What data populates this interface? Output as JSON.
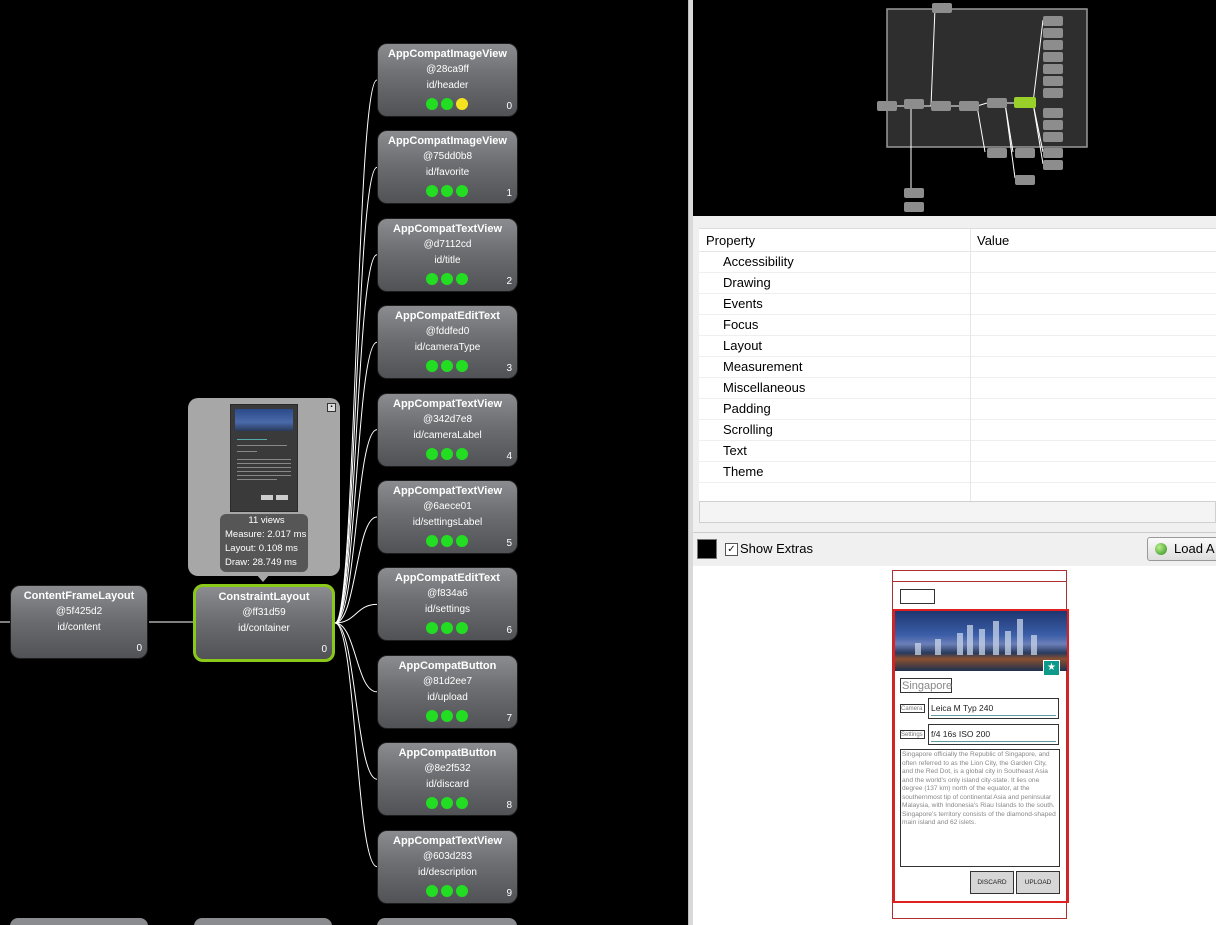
{
  "tree": {
    "root": {
      "name": "ContentFrameLayout",
      "hash": "@5f425d2",
      "id": "id/content",
      "index": "0"
    },
    "selected": {
      "name": "ConstraintLayout",
      "hash": "@ff31d59",
      "id": "id/container",
      "index": "0"
    },
    "popup": {
      "views": "11 views",
      "measure": "Measure: 2.017 ms",
      "layout": "Layout: 0.108 ms",
      "draw": "Draw: 28.749 ms"
    },
    "children": [
      {
        "name": "AppCompatImageView",
        "hash": "@28ca9ff",
        "id": "id/header",
        "index": "0",
        "dots": [
          "green",
          "green",
          "yellow"
        ]
      },
      {
        "name": "AppCompatImageView",
        "hash": "@75dd0b8",
        "id": "id/favorite",
        "index": "1",
        "dots": [
          "green",
          "green",
          "green"
        ]
      },
      {
        "name": "AppCompatTextView",
        "hash": "@d7112cd",
        "id": "id/title",
        "index": "2",
        "dots": [
          "green",
          "green",
          "green"
        ]
      },
      {
        "name": "AppCompatEditText",
        "hash": "@fddfed0",
        "id": "id/cameraType",
        "index": "3",
        "dots": [
          "green",
          "green",
          "green"
        ]
      },
      {
        "name": "AppCompatTextView",
        "hash": "@342d7e8",
        "id": "id/cameraLabel",
        "index": "4",
        "dots": [
          "green",
          "green",
          "green"
        ]
      },
      {
        "name": "AppCompatTextView",
        "hash": "@6aece01",
        "id": "id/settingsLabel",
        "index": "5",
        "dots": [
          "green",
          "green",
          "green"
        ]
      },
      {
        "name": "AppCompatEditText",
        "hash": "@f834a6",
        "id": "id/settings",
        "index": "6",
        "dots": [
          "green",
          "green",
          "green"
        ]
      },
      {
        "name": "AppCompatButton",
        "hash": "@81d2ee7",
        "id": "id/upload",
        "index": "7",
        "dots": [
          "green",
          "green",
          "green"
        ]
      },
      {
        "name": "AppCompatButton",
        "hash": "@8e2f532",
        "id": "id/discard",
        "index": "8",
        "dots": [
          "green",
          "green",
          "green"
        ]
      },
      {
        "name": "AppCompatTextView",
        "hash": "@603d283",
        "id": "id/description",
        "index": "9",
        "dots": [
          "green",
          "green",
          "green"
        ]
      }
    ]
  },
  "properties": {
    "header_property": "Property",
    "header_value": "Value",
    "rows": [
      "Accessibility",
      "Drawing",
      "Events",
      "Focus",
      "Layout",
      "Measurement",
      "Miscellaneous",
      "Padding",
      "Scrolling",
      "Text",
      "Theme"
    ]
  },
  "toolbar": {
    "show_extras_label": "Show Extras",
    "show_extras_checked": true,
    "load_label": "Load A"
  },
  "preview": {
    "title": "Singapore",
    "camera_label": "Camera",
    "camera_value": "Leica M Typ 240",
    "settings_label": "Settings",
    "settings_value": "f/4 16s ISO 200",
    "description": "Singapore officially the Republic of Singapore, and often referred to as the Lion City, the Garden City, and the Red Dot, is a global city in Southeast Asia and the world's only island city-state. It lies one degree (137 km) north of the equator, at the southernmost tip of continental Asia and peninsular Malaysia, with Indonesia's Riau Islands to the south. Singapore's territory consists of the diamond-shaped main island and 62 islets.",
    "discard_label": "DISCARD",
    "upload_label": "UPLOAD"
  },
  "colors": {
    "selected_border": "#8ac81a",
    "dot_green": "#22dd22",
    "dot_yellow": "#f4e11f",
    "highlight_red": "#e02020"
  }
}
